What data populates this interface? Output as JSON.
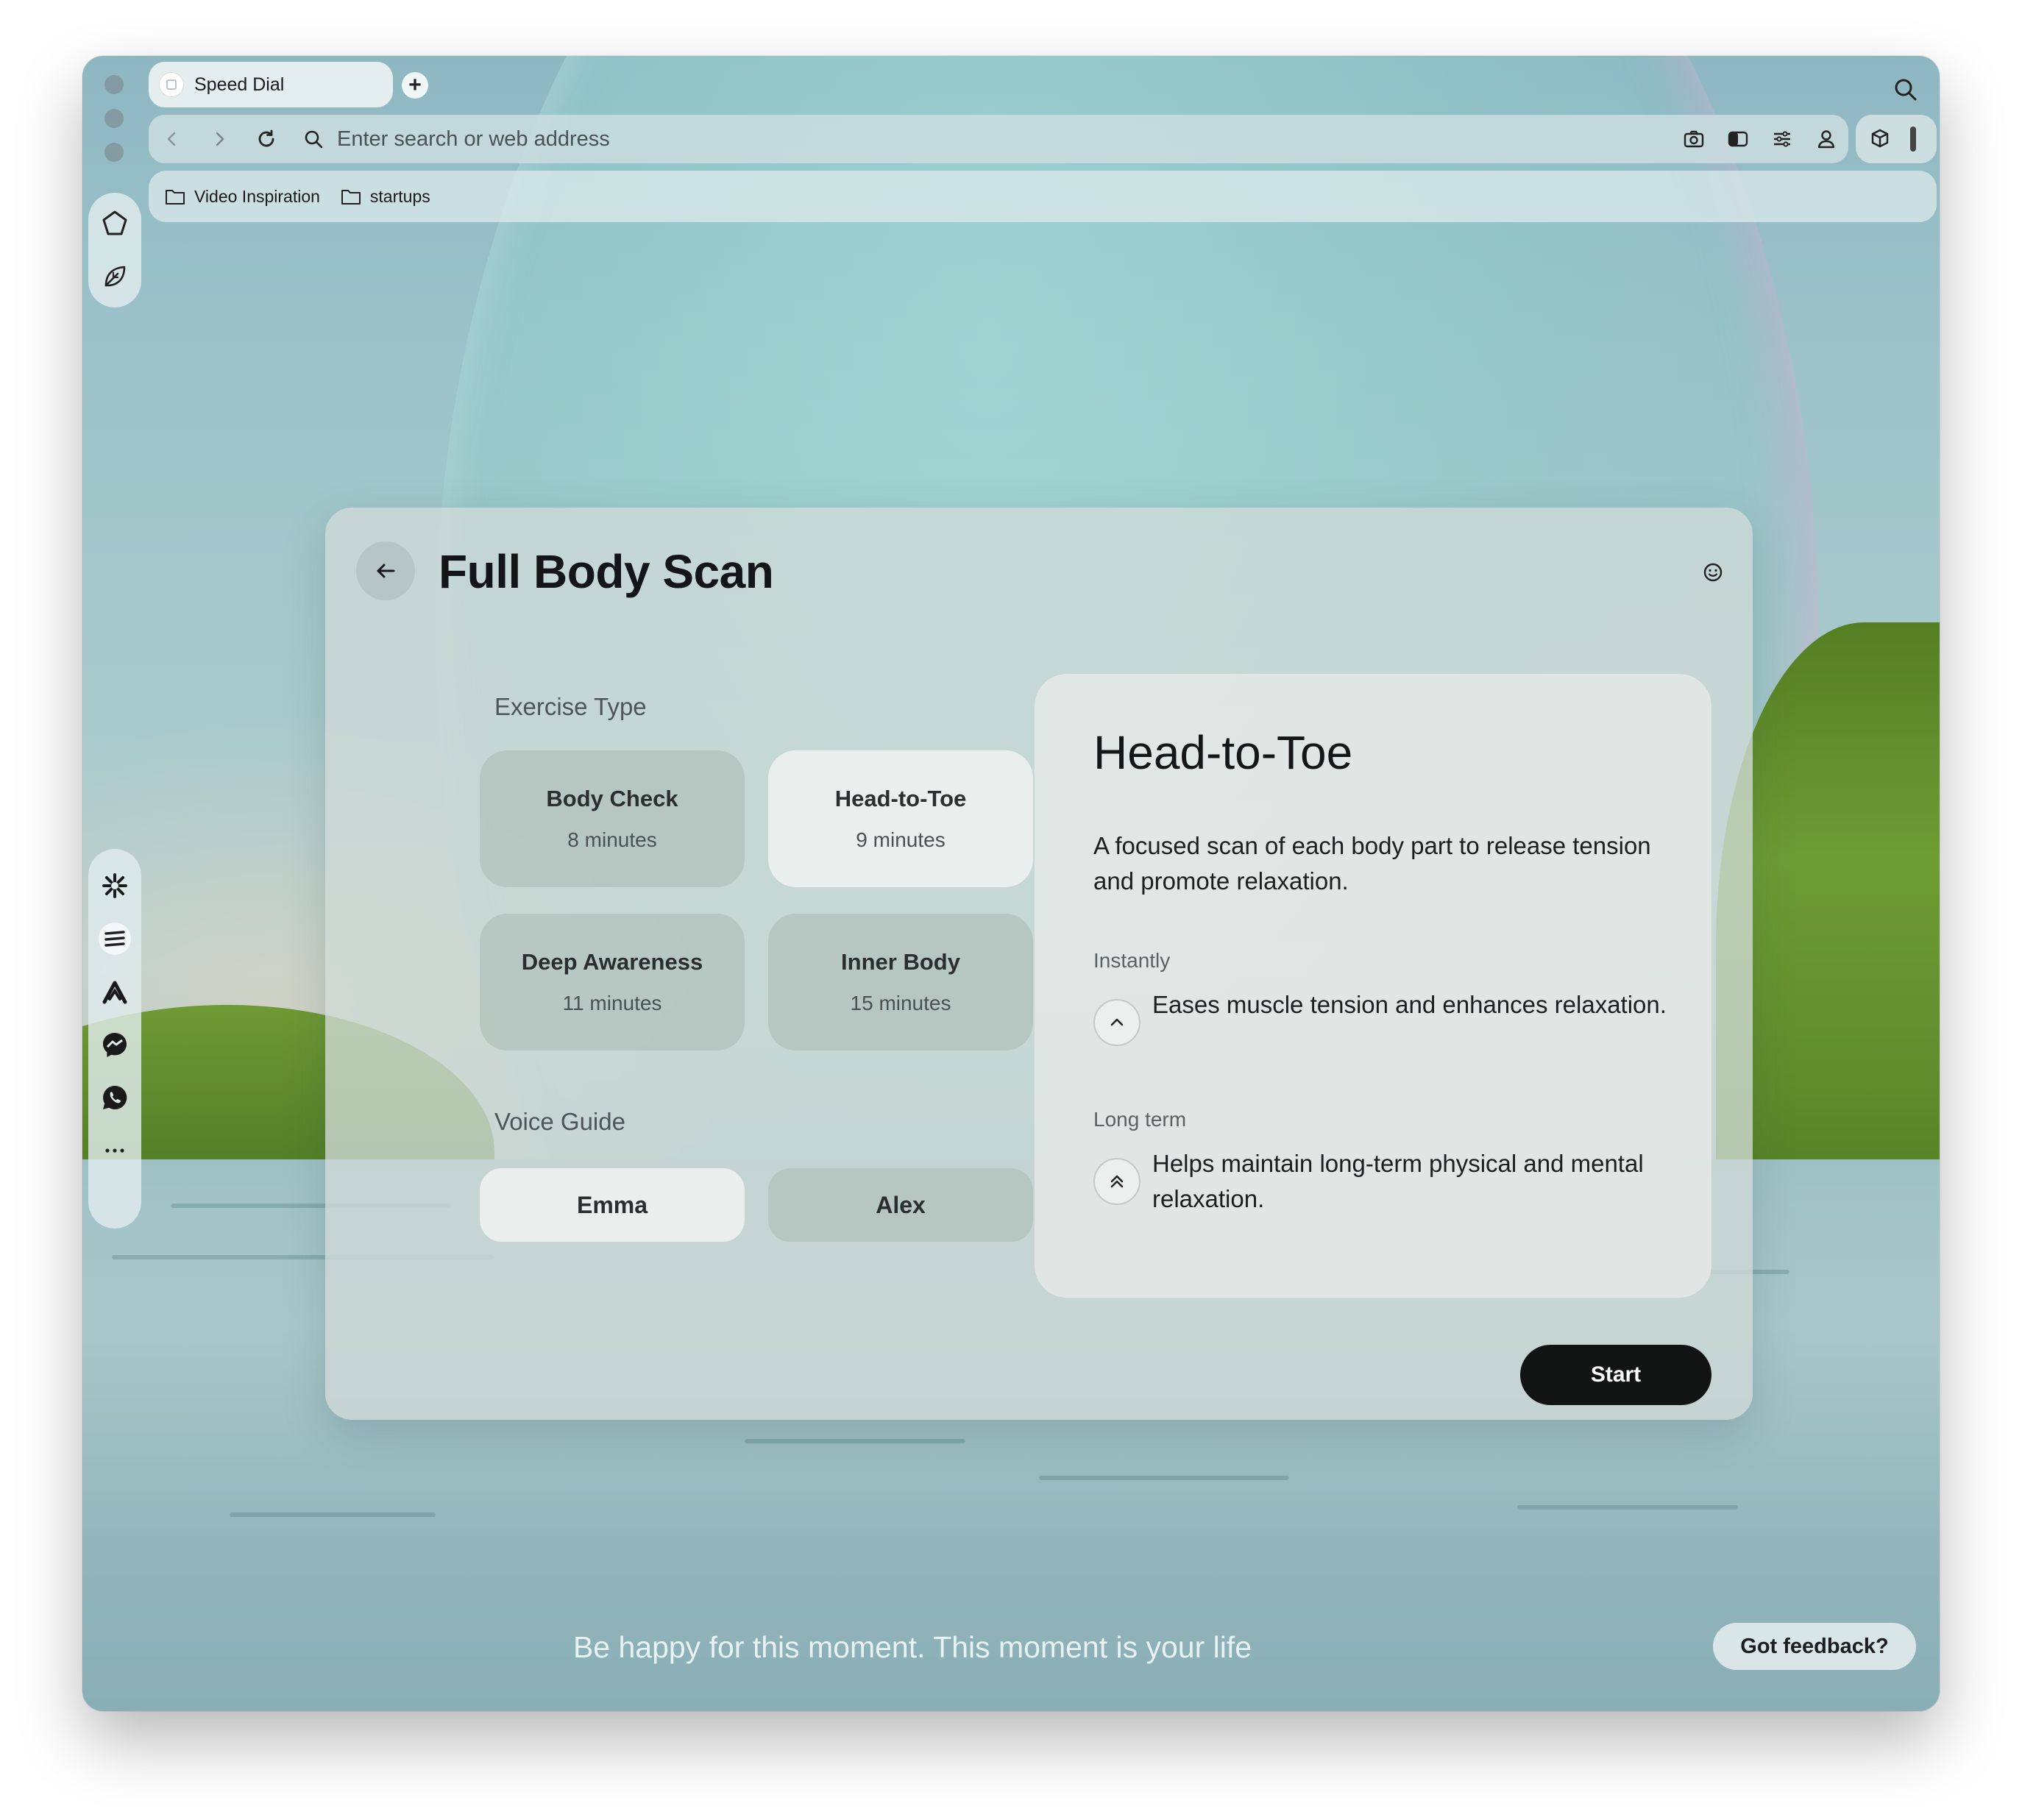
{
  "browser": {
    "tab": {
      "label": "Speed Dial"
    },
    "address_bar": {
      "placeholder": "Enter search or web address"
    },
    "bookmarks": [
      {
        "label": "Video Inspiration"
      },
      {
        "label": "startups"
      }
    ]
  },
  "card": {
    "title": "Full Body Scan",
    "exercise_type_label": "Exercise Type",
    "exercises": [
      {
        "name": "Body Check",
        "duration": "8 minutes",
        "selected": false
      },
      {
        "name": "Head-to-Toe",
        "duration": "9 minutes",
        "selected": true
      },
      {
        "name": "Deep Awareness",
        "duration": "11 minutes",
        "selected": false
      },
      {
        "name": "Inner Body",
        "duration": "15 minutes",
        "selected": false
      }
    ],
    "voice_guide_label": "Voice Guide",
    "voices": [
      {
        "name": "Emma",
        "selected": true
      },
      {
        "name": "Alex",
        "selected": false
      }
    ],
    "detail": {
      "title": "Head-to-Toe",
      "description": "A focused scan of each body part to release tension and promote relaxation.",
      "instantly_label": "Instantly",
      "instantly_text": "Eases muscle tension and enhances relaxation.",
      "long_term_label": "Long term",
      "long_term_text": "Helps maintain long-term physical and mental relaxation."
    },
    "start_label": "Start"
  },
  "quote": "Be happy for this moment. This moment is your life",
  "feedback_label": "Got feedback?",
  "icons": {
    "tab_favicon": "speed-dial-icon",
    "new_tab": "plus-icon",
    "top_search": "search-icon",
    "nav": [
      "back-icon",
      "forward-icon",
      "reload-icon",
      "search-icon"
    ],
    "address_right": [
      "camera-icon",
      "contrast-icon",
      "sliders-icon",
      "account-icon",
      "extensions-cube-icon"
    ],
    "sidebar_top": [
      "home-pentagon-icon",
      "leaf-icon"
    ],
    "sidebar_apps": [
      "perplexity-icon",
      "stripe-icon",
      "vivaldi-icon",
      "messenger-icon",
      "whatsapp-icon",
      "more-icon"
    ],
    "benefits": [
      "chevron-up-icon",
      "double-chevron-up-icon"
    ]
  },
  "colors": {
    "start_button": "#121414",
    "selected_option": "#ecf0ee",
    "unselected_option": "#aab9b2"
  }
}
